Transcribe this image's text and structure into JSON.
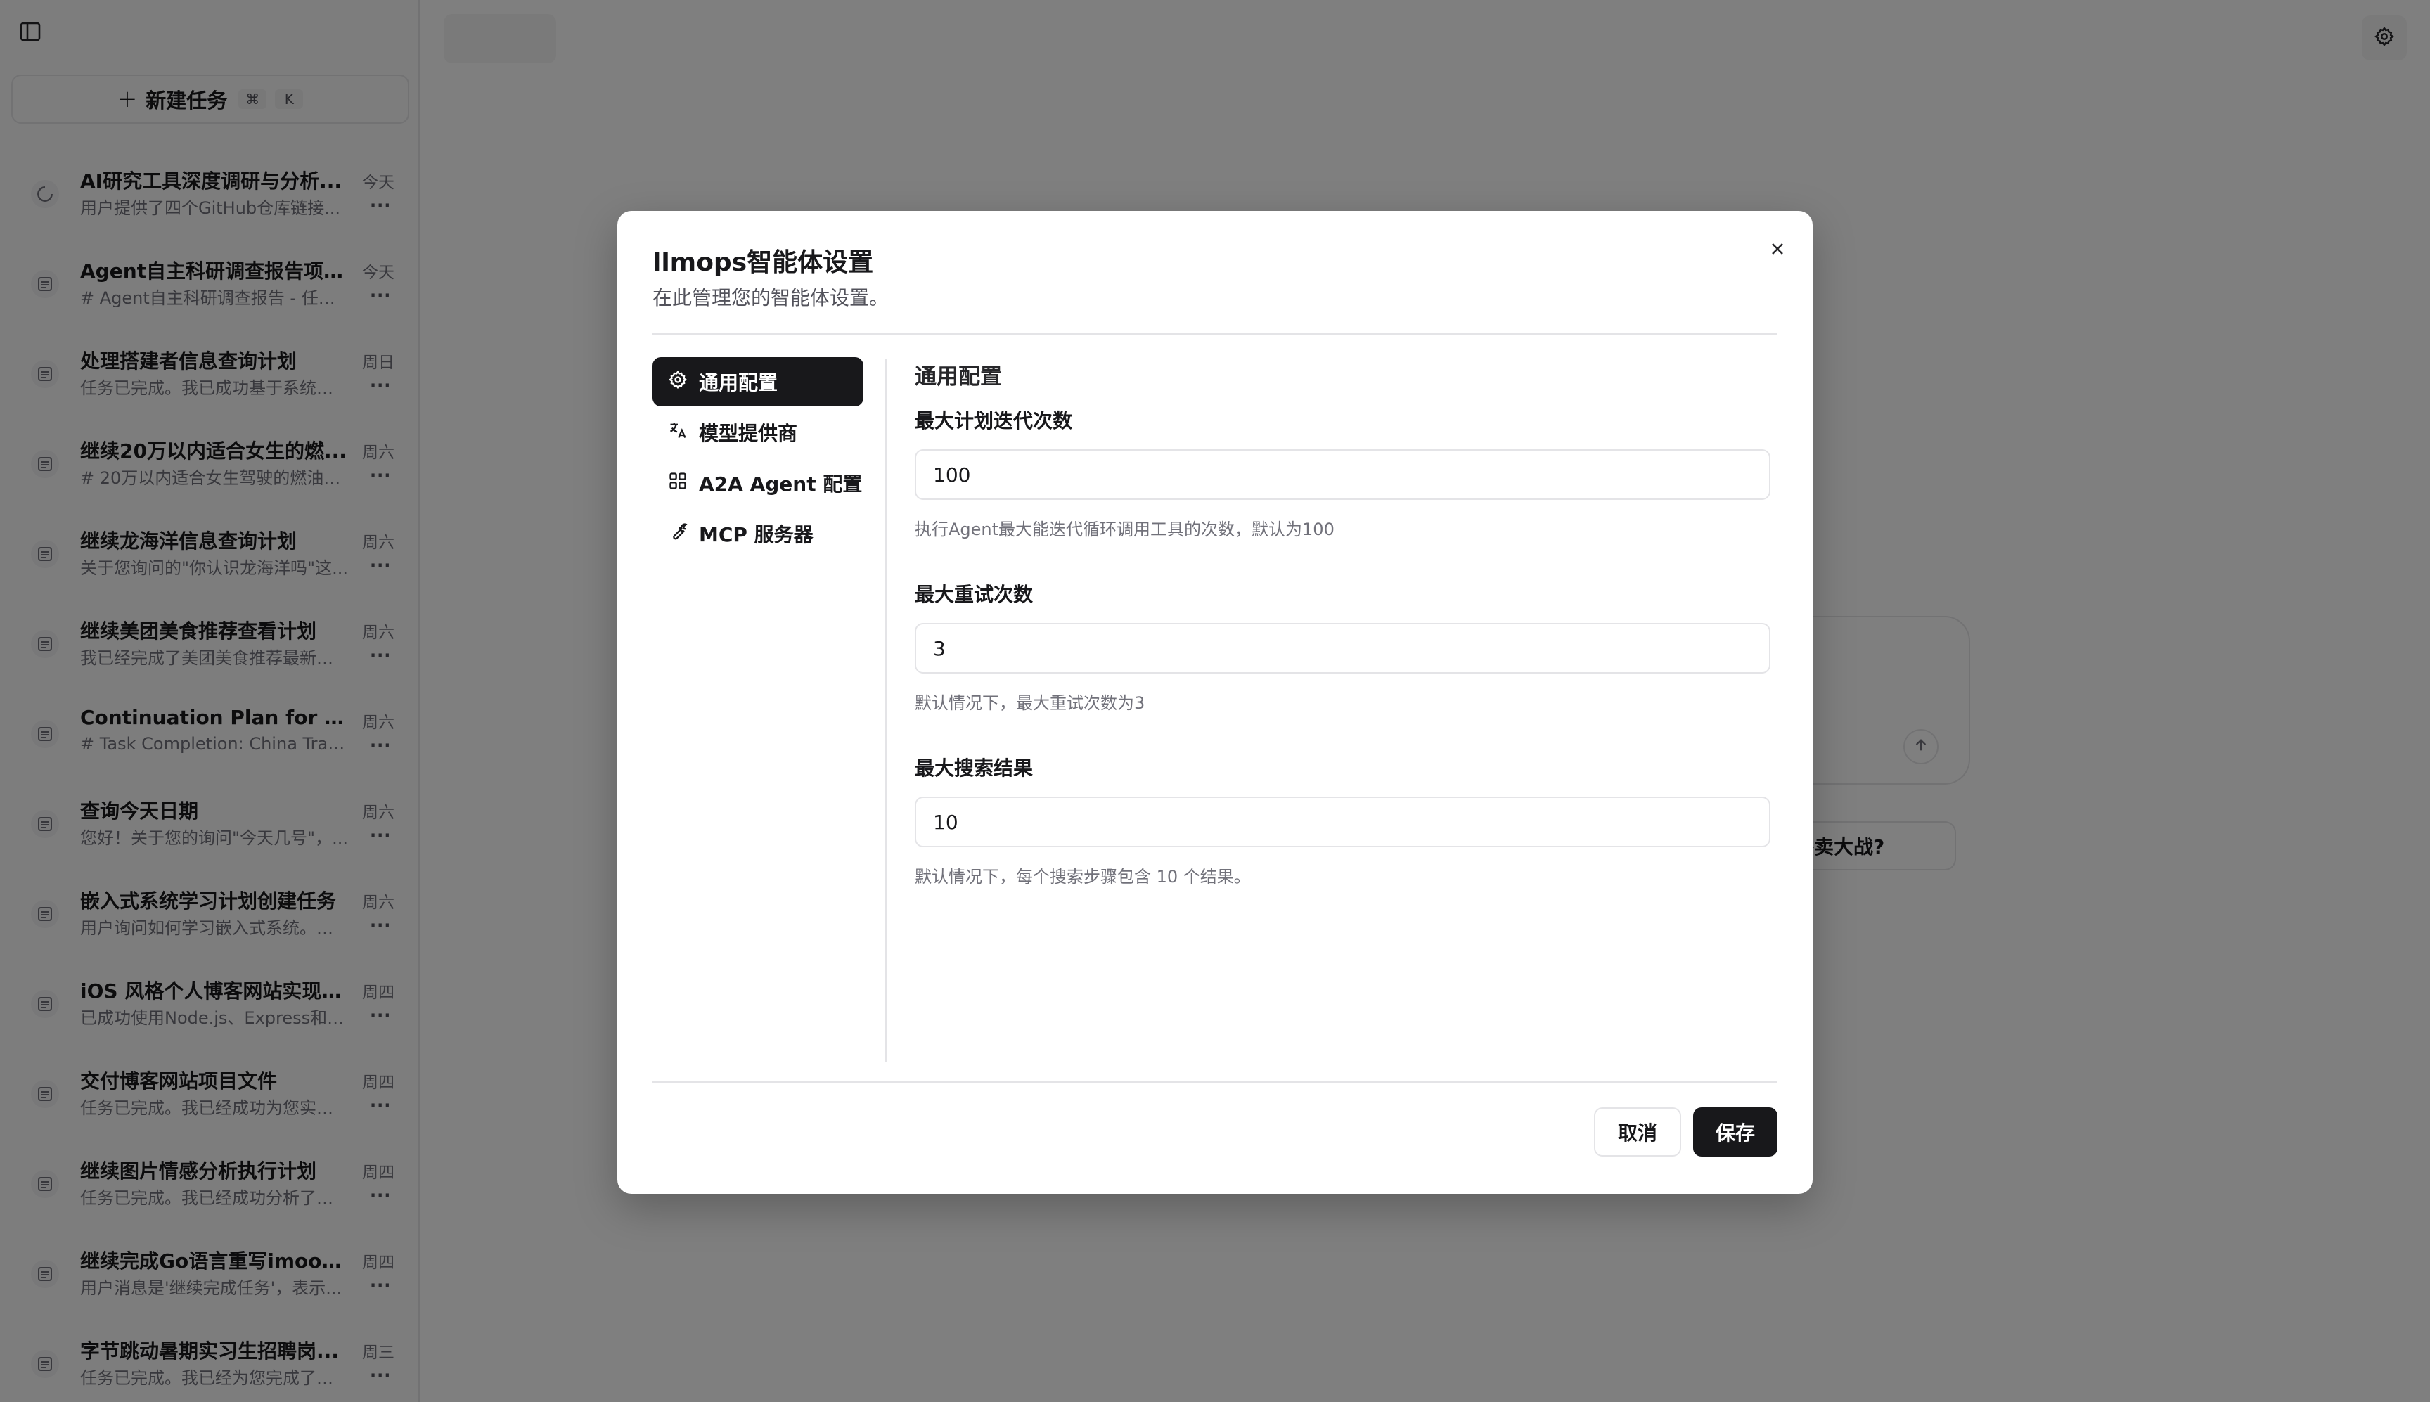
{
  "sidebar": {
    "toggle_icon": "sidebar-panel-icon",
    "new_task": {
      "label": "新建任务",
      "shortcut_mod": "⌘",
      "shortcut_key": "K"
    },
    "tasks": [
      {
        "title": "AI研究工具深度调研与分析...",
        "snippet": "用户提供了四个GitHub仓库链接...",
        "day": "今天",
        "icon": "loading-spinner-icon"
      },
      {
        "title": "Agent自主科研调查报告项目...",
        "snippet": "# Agent自主科研调查报告 - 任务...",
        "day": "今天",
        "icon": "task-list-icon"
      },
      {
        "title": "处理搭建者信息查询计划",
        "snippet": "任务已完成。我已成功基于系统内...",
        "day": "周日",
        "icon": "task-list-icon"
      },
      {
        "title": "继续20万以内适合女生的燃...",
        "snippet": "# 20万以内适合女生驾驶的燃油车...",
        "day": "周六",
        "icon": "task-list-icon"
      },
      {
        "title": "继续龙海洋信息查询计划",
        "snippet": "关于您询问的\"你认识龙海洋吗\"这...",
        "day": "周六",
        "icon": "task-list-icon"
      },
      {
        "title": "继续美团美食推荐查看计划",
        "snippet": "我已经完成了美团美食推荐最新信...",
        "day": "周六",
        "icon": "task-list-icon"
      },
      {
        "title": "Continuation Plan for Outp...",
        "snippet": "# Task Completion: China Travel...",
        "day": "周六",
        "icon": "task-list-icon"
      },
      {
        "title": "查询今天日期",
        "snippet": "您好！关于您的询问\"今天几号\"，...",
        "day": "周六",
        "icon": "task-list-icon"
      },
      {
        "title": "嵌入式系统学习计划创建任务",
        "snippet": "用户询问如何学习嵌入式系统。这...",
        "day": "周六",
        "icon": "task-list-icon"
      },
      {
        "title": "iOS 风格个人博客网站实现计...",
        "snippet": "已成功使用Node.js、Express和P...",
        "day": "周四",
        "icon": "task-list-icon"
      },
      {
        "title": "交付博客网站项目文件",
        "snippet": "任务已完成。我已经成功为您实现...",
        "day": "周四",
        "icon": "task-list-icon"
      },
      {
        "title": "继续图片情感分析执行计划",
        "snippet": "任务已完成。我已经成功分析了您...",
        "day": "周四",
        "icon": "task-list-icon"
      },
      {
        "title": "继续完成Go语言重写imooc-...",
        "snippet": "用户消息是'继续完成任务'，表示...",
        "day": "周四",
        "icon": "task-list-icon"
      },
      {
        "title": "字节跳动暑期实习生招聘岗...",
        "snippet": "任务已完成。我已经为您完成了字...",
        "day": "周三",
        "icon": "task-list-icon"
      }
    ],
    "more_label": "..."
  },
  "main": {
    "suggestion_chip": "的外卖大战?",
    "settings_icon": "gear-icon",
    "send_icon": "arrow-up-icon"
  },
  "dialog": {
    "title": "llmops智能体设置",
    "subtitle": "在此管理您的智能体设置。",
    "nav": [
      {
        "label": "通用配置",
        "icon": "gear-icon",
        "active": true
      },
      {
        "label": "模型提供商",
        "icon": "translate-icon",
        "active": false
      },
      {
        "label": "A2A Agent 配置",
        "icon": "grid-icon",
        "active": false
      },
      {
        "label": "MCP 服务器",
        "icon": "wrench-icon",
        "active": false
      }
    ],
    "section_title": "通用配置",
    "fields": [
      {
        "label": "最大计划迭代次数",
        "value": "100",
        "help": "执行Agent最大能迭代循环调用工具的次数，默认为100"
      },
      {
        "label": "最大重试次数",
        "value": "3",
        "help": "默认情况下，最大重试次数为3"
      },
      {
        "label": "最大搜索结果",
        "value": "10",
        "help": "默认情况下，每个搜索步骤包含 10 个结果。"
      }
    ],
    "cancel_label": "取消",
    "save_label": "保存"
  },
  "colors": {
    "primary": "#18181b",
    "overlay": "rgba(0,0,0,0.5)",
    "border": "#e4e4e7",
    "muted_text": "#71717a"
  }
}
